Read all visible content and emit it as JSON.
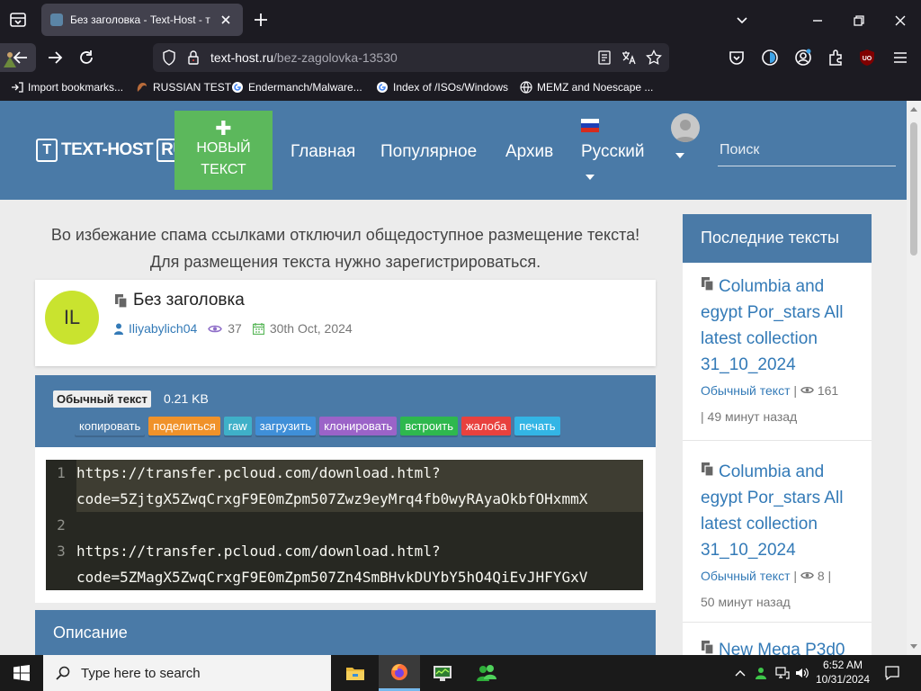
{
  "browser": {
    "tab_title": "Без заголовка - Text-Host - тек",
    "url_host": "text-host.ru",
    "url_path": "/bez-zagolovka-13530",
    "bookmarks": [
      "Import bookmarks...",
      "RUSSIAN TEST",
      "Endermanch/Malware...",
      "Index of /ISOs/Windows",
      "MEMZ and Noescape ..."
    ]
  },
  "site": {
    "logo_text": "TEXT-HOST",
    "logo_badge": "RU",
    "new_text_label": "НОВЫЙ ТЕКСТ",
    "nav": [
      "Главная",
      "Популярное",
      "Архив"
    ],
    "language": "Русский",
    "search_placeholder": "Поиск"
  },
  "notice": "Во избежание спама ссылками отключил общедоступное размещение текста! Для размещения текста нужно зарегистрироваться.",
  "post": {
    "avatar_initials": "IL",
    "title": "Без заголовка",
    "author": "Iliyabylich04",
    "views": "37",
    "date": "30th Oct, 2024",
    "type": "Обычный текст",
    "size": "0.21 KB",
    "actions": [
      {
        "label": "копировать",
        "color": "#4a7aa7"
      },
      {
        "label": "поделиться",
        "color": "#f0922a"
      },
      {
        "label": "raw",
        "color": "#3fb0c8"
      },
      {
        "label": "загрузить",
        "color": "#3f8fd8"
      },
      {
        "label": "клонировать",
        "color": "#9b63c8"
      },
      {
        "label": "встроить",
        "color": "#2eb84e"
      },
      {
        "label": "жалоба",
        "color": "#e8413e"
      },
      {
        "label": "печать",
        "color": "#33b5e5"
      }
    ],
    "code_lines": [
      {
        "num": "1",
        "lines": [
          "https://transfer.pcloud.com/download.html?",
          "code=5ZjtgX5ZwqCrxgF9E0mZpm507Zwz9eyMrq4fb0wyRAyaOkbfOHxmmX"
        ]
      },
      {
        "num": "2",
        "lines": [
          ""
        ]
      },
      {
        "num": "3",
        "lines": [
          "https://transfer.pcloud.com/download.html?",
          "code=5ZMagX5ZwqCrxgF9E0mZpm507Zn4SmBHvkDUYbY5hO4QiEvJHFYGxV"
        ]
      }
    ],
    "description_heading": "Описание"
  },
  "sidebar": {
    "heading": "Последние тексты",
    "items": [
      {
        "title": "Columbia and egypt Por_stars All latest collection 31_10_2024",
        "kind": "Обычный текст",
        "sep": "|",
        "views": "161",
        "ago": "| 49 минут назад"
      },
      {
        "title": "Columbia and egypt Por_stars All latest collection 31_10_2024",
        "kind": "Обычный текст",
        "sep": "|",
        "views": "8 |",
        "ago": "50 минут назад"
      },
      {
        "title": "New Mega P3d0"
      }
    ]
  },
  "taskbar": {
    "search_placeholder": "Type here to search",
    "time": "6:52 AM",
    "date": "10/31/2024",
    "pinned_apps": [
      "file-explorer-icon",
      "firefox-icon",
      "task-manager-icon",
      "users-icon"
    ]
  },
  "colors": {
    "header": "#4a7aa7",
    "new_button": "#5cb85c",
    "link": "#337ab7",
    "code_bg": "#272822"
  }
}
